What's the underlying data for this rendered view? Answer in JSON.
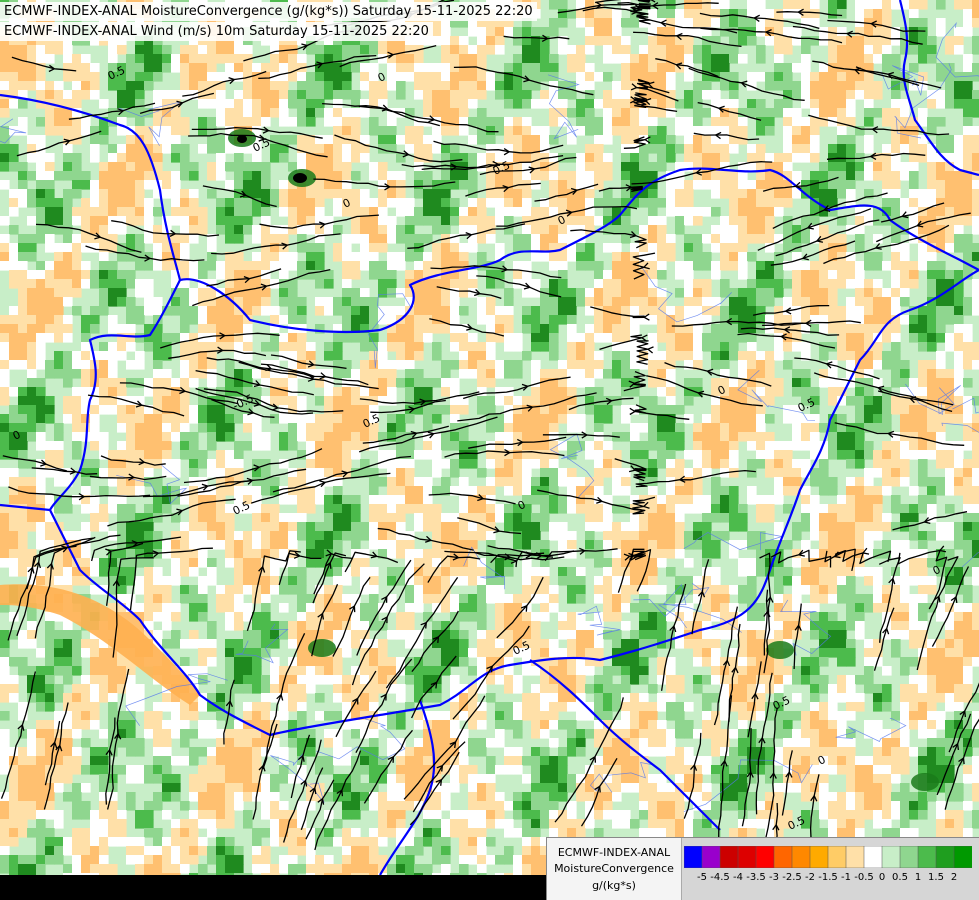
{
  "titles": [
    "ECMWF-INDEX-ANAL MoistureConvergence (g/(kg*s)) Saturday 15-11-2025 22:20",
    "ECMWF-INDEX-ANAL Wind (m/s) 10m Saturday 15-11-2025 22:20"
  ],
  "legend": {
    "model": "ECMWF-INDEX-ANAL",
    "parameter": "MoistureConvergence",
    "unit": "g/(kg*s)",
    "ticks": [
      "-5",
      "-4.5",
      "-4",
      "-3.5",
      "-3",
      "-2.5",
      "-2",
      "-1.5",
      "-1",
      "-0.5",
      "0",
      "0.5",
      "1",
      "1.5",
      "2"
    ],
    "colors": [
      "#0000ff",
      "#9900cc",
      "#cc0000",
      "#dd0000",
      "#ff0000",
      "#ff6600",
      "#ff8800",
      "#ffaa00",
      "#ffcc66",
      "#ffe0a8",
      "#ffffff",
      "#c8eec8",
      "#8fd68f",
      "#4cbb4c",
      "#1f9e1f",
      "#009900"
    ]
  },
  "map": {
    "contour_labels": [
      "0.5",
      "0",
      "0.5",
      "0",
      "0.5",
      "0",
      "-0.5",
      "0.5",
      "0",
      "0.5",
      "0",
      "0.5",
      "0",
      "0.5",
      "0",
      "0.5",
      "0",
      "0.5"
    ],
    "colors": {
      "border": "#0000ff",
      "river": "#5577ee",
      "streamline": "#000000",
      "background": "#ffffff"
    }
  }
}
